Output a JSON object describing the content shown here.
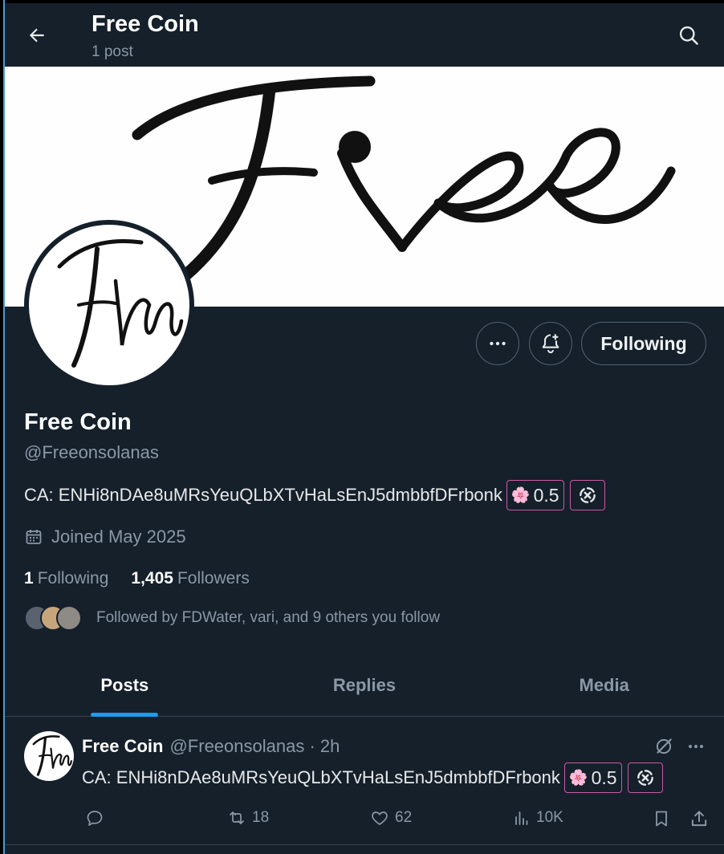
{
  "header": {
    "title": "Free Coin",
    "subtitle": "1 post",
    "back_icon": "arrow-left-icon",
    "search_icon": "search-icon"
  },
  "banner": {
    "text": "Free"
  },
  "profile": {
    "name": "Free Coin",
    "handle": "@Freeonsolanas",
    "bio": "CA: ENHi8nDAe8uMRsYeuQLbXTvHaLsEnJ5dmbbfDFrbonk",
    "chip_value": "0.5",
    "joined": "Joined May 2025",
    "following_count": "1",
    "following_label": "Following",
    "followers_count": "1,405",
    "followers_label": "Followers",
    "followed_by": "Followed by FDWater, vari, and 9 others you follow"
  },
  "actions": {
    "more_icon": "more-icon",
    "notify_icon": "bell-plus-icon",
    "follow_label": "Following"
  },
  "tabs": [
    {
      "label": "Posts",
      "active": true
    },
    {
      "label": "Replies",
      "active": false
    },
    {
      "label": "Media",
      "active": false
    }
  ],
  "post": {
    "name": "Free Coin",
    "meta": "@Freeonsolanas · 2h",
    "text": "CA: ENHi8nDAe8uMRsYeuQLbXTvHaLsEnJ5dmbbfDFrbonk",
    "chip_value": "0.5",
    "replies": "",
    "reposts": "18",
    "likes": "62",
    "views": "10K"
  },
  "colors": {
    "background": "#15202b",
    "accent": "#1d9bf0",
    "muted": "#8b98a5",
    "chip_border": "#c85aa6"
  }
}
